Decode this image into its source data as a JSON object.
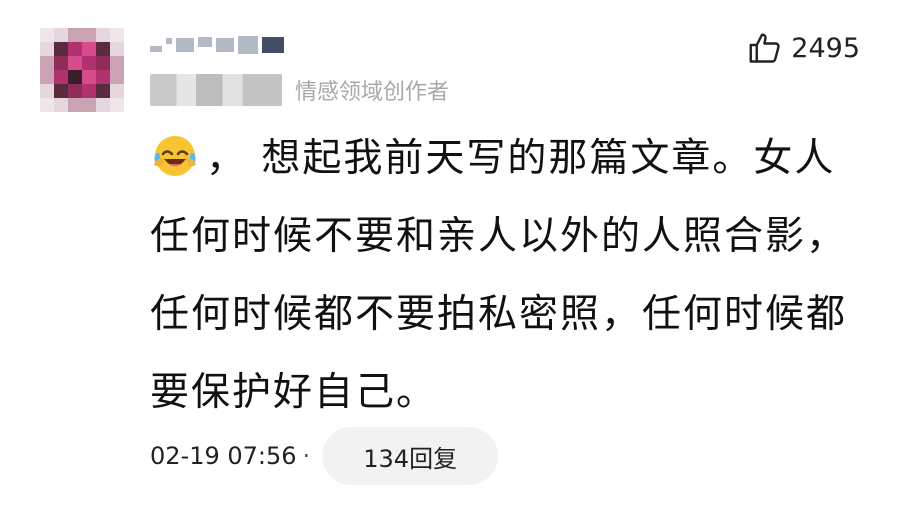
{
  "comment": {
    "author_tag": "情感领域创作者",
    "likes": "2495",
    "text": "，  想起我前天写的那篇文章。女人任何时候不要和亲人以外的人照合影，任何时候都不要拍私密照，任何时候都要保护好自己。",
    "emoji": "laughing-crying-emoji",
    "timestamp": "02-19 07:56",
    "separator": "·",
    "reply_label": "134回复"
  },
  "colors": {
    "text": "#111111",
    "muted": "#a9a9a9",
    "reply_bg": "#f2f2f2",
    "avatar_palette": [
      "#5a2b3e",
      "#b2326f",
      "#d64c8c",
      "#8f2d58",
      "#c9a3b4",
      "#e6d7de",
      "#3c1d2a",
      "#f0e6ea"
    ]
  }
}
